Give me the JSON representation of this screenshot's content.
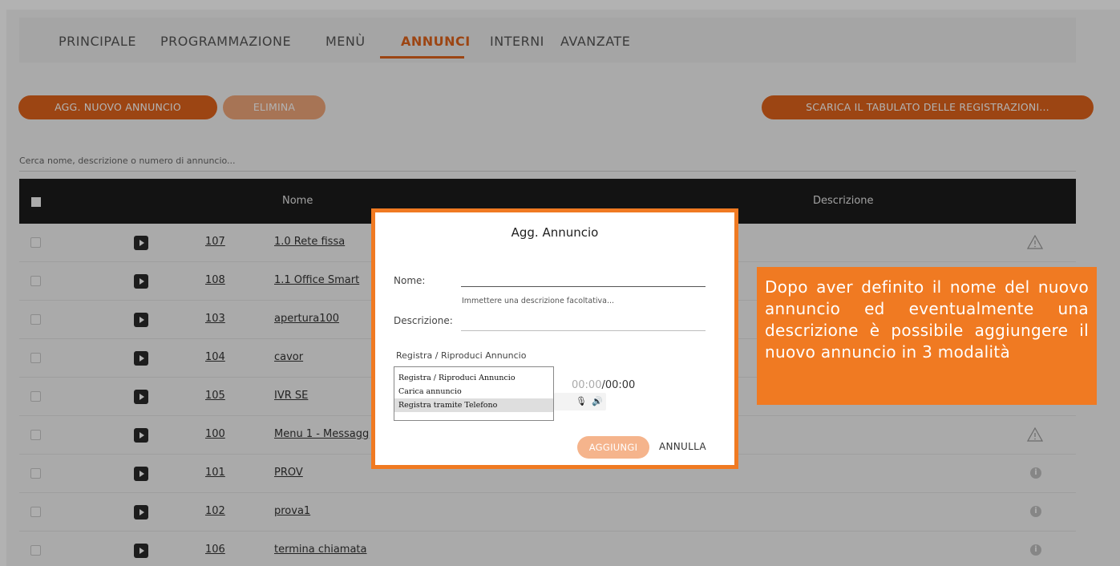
{
  "nav": {
    "tabs": [
      {
        "label": "PRINCIPALE"
      },
      {
        "label": "PROGRAMMAZIONE"
      },
      {
        "label": "MENÙ"
      },
      {
        "label": "ANNUNCI",
        "active": true
      },
      {
        "label": "INTERNI"
      },
      {
        "label": "AVANZATE"
      }
    ]
  },
  "toolbar": {
    "add_label": "AGG. NUOVO ANNUNCIO",
    "delete_label": "ELIMINA",
    "download_label": "SCARICA IL TABULATO DELLE REGISTRAZIONI..."
  },
  "search": {
    "placeholder": "Cerca nome, descrizione o numero di annuncio..."
  },
  "table": {
    "headers": {
      "name": "Nome",
      "description": "Descrizione"
    },
    "rows": [
      {
        "number": "107",
        "name": "1.0 Rete fissa",
        "status_icon": "warning-icon"
      },
      {
        "number": "108",
        "name": "1.1 Office Smart",
        "status_icon": ""
      },
      {
        "number": "103",
        "name": "apertura100",
        "status_icon": ""
      },
      {
        "number": "104",
        "name": "cavor",
        "status_icon": ""
      },
      {
        "number": "105",
        "name": "IVR SE",
        "status_icon": ""
      },
      {
        "number": "100",
        "name": "Menu 1 - Messagg",
        "status_icon": "warning-icon"
      },
      {
        "number": "101",
        "name": "PROV",
        "status_icon": "info-icon"
      },
      {
        "number": "102",
        "name": "prova1",
        "status_icon": "info-icon"
      },
      {
        "number": "106",
        "name": "termina chiamata",
        "status_icon": "info-icon"
      }
    ]
  },
  "modal": {
    "title": "Agg. Annuncio",
    "name_label": "Nome:",
    "description_label": "Descrizione:",
    "description_placeholder": "Immettere una descrizione facoltativa...",
    "mode_label": "Registra / Riproduci Annuncio",
    "mode_options": [
      "Registra / Riproduci Annuncio",
      "Carica annuncio",
      "Registra tramite Telefono"
    ],
    "selected_option": "Registra tramite Telefono",
    "timer_elapsed": "00:00",
    "timer_total": "00:00",
    "add_label": "AGGIUNGI",
    "cancel_label": "ANNULLA"
  },
  "callout": {
    "text": "Dopo aver definito il nome del nuovo annuncio ed eventualmente una descrizione è possibile aggiungere il nuovo annuncio in 3 modalità"
  },
  "colors": {
    "accent": "#e0631c",
    "callout": "#f07a22",
    "table_header": "#1c1c1c"
  }
}
